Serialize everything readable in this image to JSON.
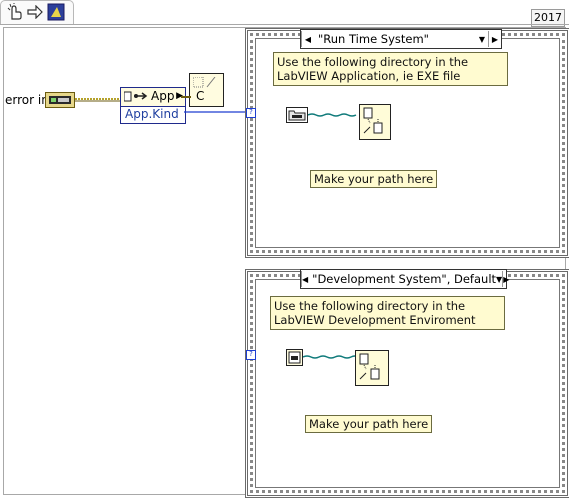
{
  "toolbar": {
    "icons": [
      "run-pointer-icon",
      "step-arrow-icon",
      "highlight-execution-icon"
    ],
    "version": "2017"
  },
  "error_in": {
    "label": "error in"
  },
  "property_node": {
    "class_label": "App",
    "property_label": "App.Kind"
  },
  "constant_node": {
    "letter": "C"
  },
  "case_run_time": {
    "selector": "\"Run Time System\"",
    "note": "Use the following directory in the LabVIEW Application, ie EXE file",
    "label": "Make your path here"
  },
  "case_development": {
    "selector": "\"Development System\", Default",
    "note": "Use the following directory in the LabVIEW Development Enviroment",
    "label": "Make your path here"
  },
  "colors": {
    "error_wire": "#b5a22c",
    "enum_wire": "#1e3fd0",
    "path_wire": "#0f7a7a",
    "note_bg": "#fffbd0",
    "frame": "#a8a8a8"
  }
}
